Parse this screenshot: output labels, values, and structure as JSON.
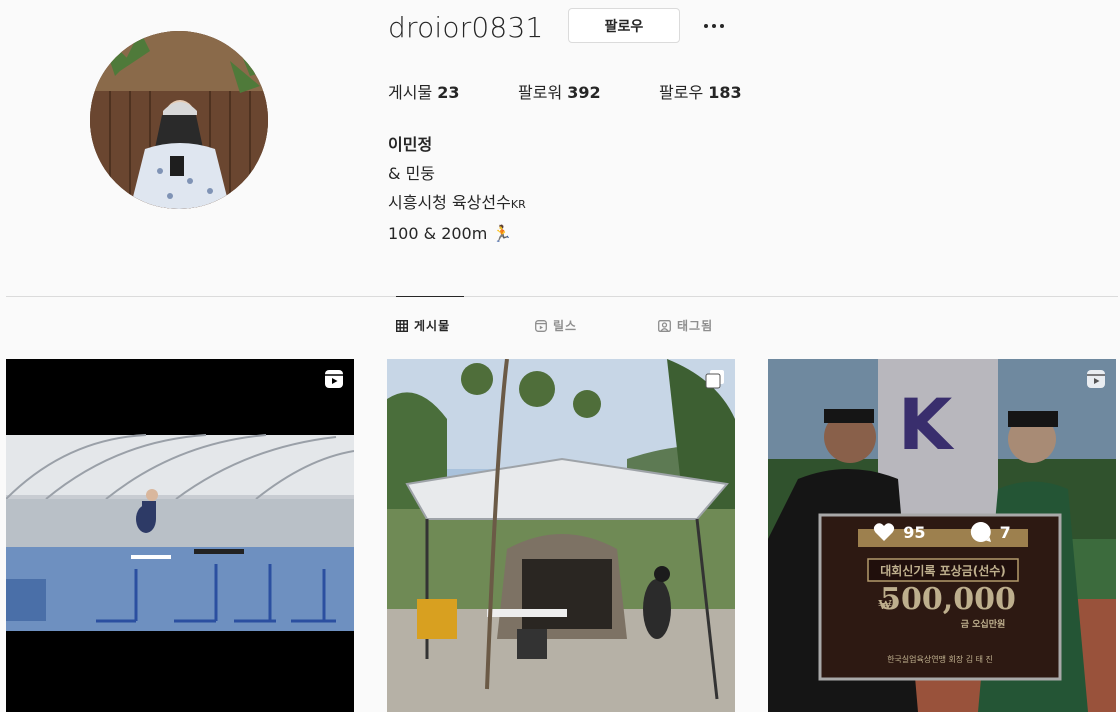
{
  "profile": {
    "username": "droior0831",
    "follow_label": "팔로우",
    "more_label": "옵션 더 보기"
  },
  "stats": [
    {
      "label": "게시물",
      "value": "23"
    },
    {
      "label": "팔로워",
      "value": "392"
    },
    {
      "label": "팔로우",
      "value": "183"
    }
  ],
  "bio": {
    "name": "이민정",
    "line1": "& 민둥",
    "line2": "시흥시청 육상선수",
    "line2_suffix": "KR",
    "line3": "100 & 200m 🏃"
  },
  "tabs": [
    {
      "label": "게시물",
      "icon": "grid-icon",
      "active": true
    },
    {
      "label": "릴스",
      "icon": "reels-icon",
      "active": false
    },
    {
      "label": "태그됨",
      "icon": "tagged-icon",
      "active": false
    }
  ],
  "posts": [
    {
      "type": "reel",
      "badge_icon": "reels-icon"
    },
    {
      "type": "carousel",
      "badge_icon": "carousel-icon"
    },
    {
      "type": "reel",
      "badge_icon": "reels-icon",
      "likes": "95",
      "comments": "7",
      "photo_text": {
        "title": "대회신기록 포상금(선수)",
        "amount": "500,000",
        "amount_prefix": "₩",
        "amount_words": "금 오십만원",
        "signature": "한국실업육상연맹 회장 김 태 진"
      }
    }
  ],
  "colors": {
    "text": "#262626",
    "muted": "#8e8e8e",
    "border": "#dbdbdb",
    "background": "#fafafa"
  }
}
